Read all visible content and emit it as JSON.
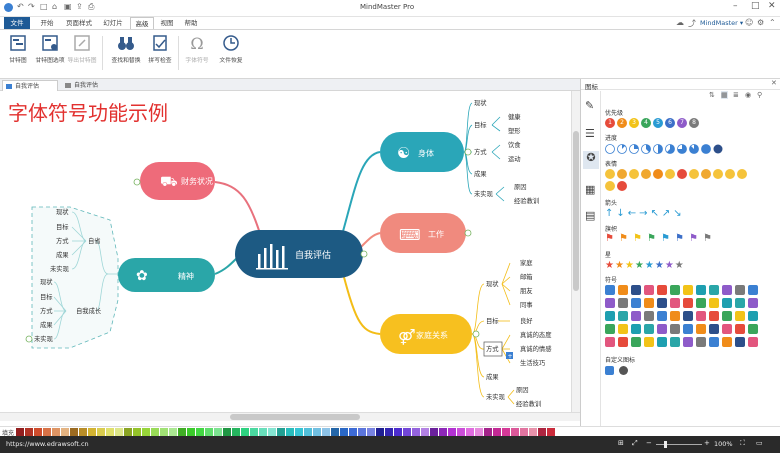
{
  "app": {
    "title": "MindMaster Pro",
    "account": "MindMaster ▾"
  },
  "tabs": [
    {
      "label": "文件"
    },
    {
      "label": "开始"
    },
    {
      "label": "页面样式"
    },
    {
      "label": "幻灯片"
    },
    {
      "label": "高级"
    },
    {
      "label": "视图"
    },
    {
      "label": "帮助"
    }
  ],
  "ribbon": {
    "buttons": [
      {
        "label": "甘特图"
      },
      {
        "label": "甘特图选项"
      },
      {
        "label": "导出甘特图"
      },
      {
        "label": "查找和替换"
      },
      {
        "label": "拼写检查"
      },
      {
        "label": "字体符号"
      },
      {
        "label": "文件恢复"
      }
    ]
  },
  "doc_tabs": [
    {
      "label": "自我评估"
    },
    {
      "label": "自我评估"
    }
  ],
  "canvas": {
    "heading": "字体符号功能示例"
  },
  "mindmap": {
    "center": "自我评估",
    "nodes": {
      "health": {
        "label": "身体",
        "leaves": [
          "现状",
          "目标",
          "健康",
          "塑形",
          "方式",
          "饮食",
          "运动",
          "成果",
          "未实现",
          "原因",
          "经验教训"
        ]
      },
      "work": {
        "label": "工作"
      },
      "family": {
        "label": "家庭关系",
        "leaves": [
          "现状",
          "家庭",
          "邮箱",
          "朋友",
          "同事",
          "目标",
          "良好",
          "方式",
          "真诚的态度",
          "真诚的情感",
          "生活技巧",
          "成果",
          "未实现",
          "原因",
          "经验教训"
        ]
      },
      "finance": {
        "label": "财务状况"
      },
      "spirit": {
        "label": "精神",
        "leaves": [
          "现状",
          "目标",
          "方式",
          "自省",
          "成果",
          "未实现",
          "现状",
          "目标",
          "方式",
          "自我成长",
          "成果",
          "未实现"
        ]
      }
    }
  },
  "panel": {
    "title": "图标",
    "sections": [
      {
        "label": "优先级"
      },
      {
        "label": "进度"
      },
      {
        "label": "表情"
      },
      {
        "label": "箭头"
      },
      {
        "label": "旗帜"
      },
      {
        "label": "星"
      },
      {
        "label": "符号"
      },
      {
        "label": "自定义图标"
      }
    ],
    "priority_numbers": [
      "1",
      "2",
      "3",
      "4",
      "5",
      "6",
      "7",
      "8"
    ],
    "colors": {
      "p1": "#e64b3b",
      "p2": "#f08c1a",
      "p3": "#f2c318",
      "p4": "#3aa65b",
      "p5": "#2a9bd3",
      "p6": "#3c6fc8",
      "p7": "#8e5bc9",
      "p8": "#7a7a7a"
    }
  },
  "status": {
    "url": "https://www.edrawsoft.cn",
    "zoom": "100%",
    "fill_label": "填充"
  }
}
